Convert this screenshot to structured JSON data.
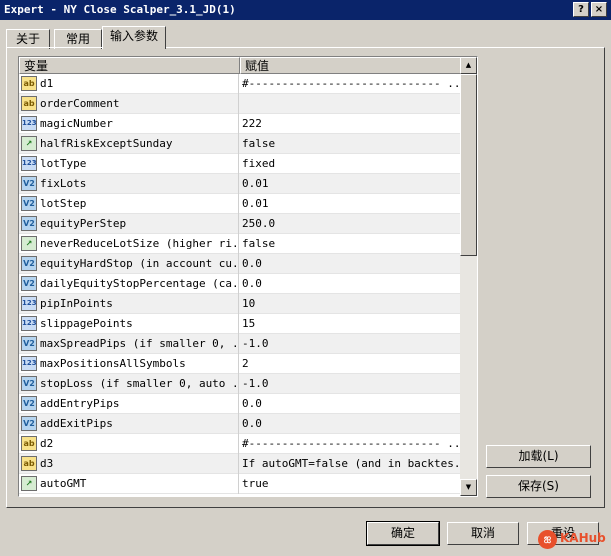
{
  "window": {
    "title": "Expert - NY Close Scalper_3.1_JD(1)",
    "help_label": "?",
    "close_label": "×"
  },
  "tabs": [
    {
      "label": "关于",
      "active": false
    },
    {
      "label": "常用",
      "active": false
    },
    {
      "label": "输入参数",
      "active": true
    }
  ],
  "grid": {
    "columns": {
      "name": "变量",
      "value": "赋值"
    },
    "rows": [
      {
        "type": "ab",
        "name": "d1",
        "value": "#----------------------------- ..."
      },
      {
        "type": "ab",
        "name": "orderComment",
        "value": ""
      },
      {
        "type": "123",
        "name": "magicNumber",
        "value": "222"
      },
      {
        "type": "bool",
        "name": "halfRiskExceptSunday",
        "value": "false"
      },
      {
        "type": "123",
        "name": "lotType",
        "value": "fixed"
      },
      {
        "type": "v2",
        "name": "fixLots",
        "value": "0.01"
      },
      {
        "type": "v2",
        "name": "lotStep",
        "value": "0.01"
      },
      {
        "type": "v2",
        "name": "equityPerStep",
        "value": "250.0"
      },
      {
        "type": "bool",
        "name": "neverReduceLotSize (higher ri...",
        "value": "false"
      },
      {
        "type": "v2",
        "name": "equityHardStop (in account cu...",
        "value": "0.0"
      },
      {
        "type": "v2",
        "name": "dailyEquityStopPercentage (ca...",
        "value": "0.0"
      },
      {
        "type": "123",
        "name": "pipInPoints",
        "value": "10"
      },
      {
        "type": "123",
        "name": "slippagePoints",
        "value": "15"
      },
      {
        "type": "v2",
        "name": "maxSpreadPips (if smaller 0, ...",
        "value": "-1.0"
      },
      {
        "type": "123",
        "name": "maxPositionsAllSymbols",
        "value": "2"
      },
      {
        "type": "v2",
        "name": "stopLoss (if smaller 0, auto ...",
        "value": "-1.0"
      },
      {
        "type": "v2",
        "name": "addEntryPips",
        "value": "0.0"
      },
      {
        "type": "v2",
        "name": "addExitPips",
        "value": "0.0"
      },
      {
        "type": "ab",
        "name": "d2",
        "value": "#----------------------------- ..."
      },
      {
        "type": "ab",
        "name": "d3",
        "value": "If autoGMT=false (and in backtes..."
      },
      {
        "type": "bool",
        "name": "autoGMT",
        "value": "true"
      }
    ]
  },
  "icons": {
    "ab": "ab",
    "123": "123",
    "v2": "V2",
    "bool": "↗"
  },
  "scroll": {
    "up": "▲",
    "down": "▼"
  },
  "side_buttons": {
    "load": "加载(L)",
    "save": "保存(S)"
  },
  "footer_buttons": {
    "ok": "确定",
    "cancel": "取消",
    "reset": "重设"
  },
  "watermark": {
    "icon": "ஐ",
    "text": "KAHub"
  }
}
